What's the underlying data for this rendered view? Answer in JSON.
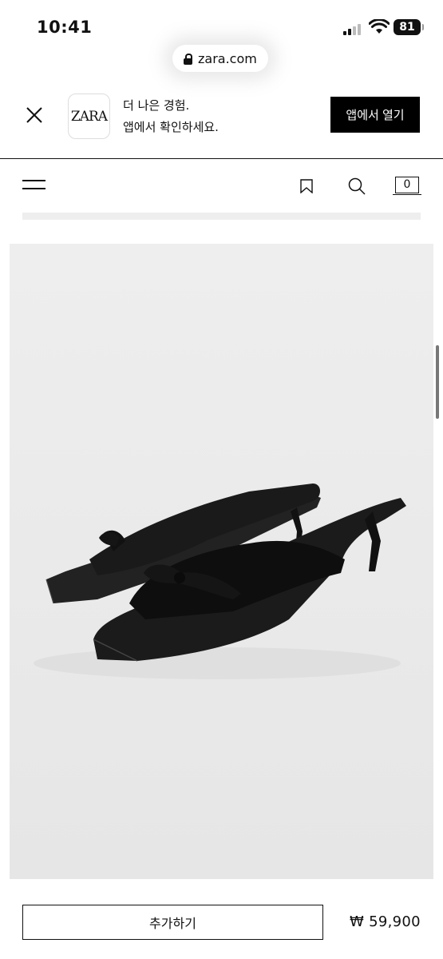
{
  "status_bar": {
    "time": "10:41",
    "battery": "81",
    "url": "zara.com"
  },
  "app_banner": {
    "logo": "ZARA",
    "line1": "더 나은 경험.",
    "line2": "앱에서 확인하세요.",
    "open_button": "앱에서 열기"
  },
  "nav": {
    "cart_count": "0"
  },
  "product": {
    "add_button": "추가하기",
    "price": "₩ 59,900"
  },
  "icons": [
    "lock-icon",
    "close-icon",
    "menu-icon",
    "bookmark-icon",
    "search-icon",
    "cart-icon"
  ]
}
